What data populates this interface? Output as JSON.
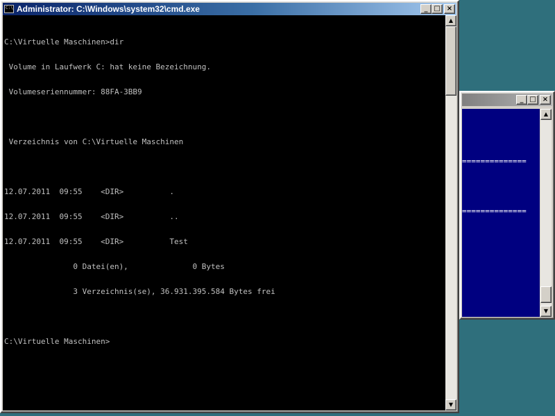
{
  "cmd_window": {
    "title": "Administrator: C:\\Windows\\system32\\cmd.exe",
    "icon_glyph": "C:\\",
    "buttons": {
      "minimize": "_",
      "maximize": "□",
      "close": "×"
    },
    "console_lines": [
      "C:\\Virtuelle Maschinen>dir",
      " Volume in Laufwerk C: hat keine Bezeichnung.",
      " Volumeseriennummer: 88FA-3BB9",
      "",
      " Verzeichnis von C:\\Virtuelle Maschinen",
      "",
      "12.07.2011  09:55    <DIR>          .",
      "12.07.2011  09:55    <DIR>          ..",
      "12.07.2011  09:55    <DIR>          Test",
      "               0 Datei(en),              0 Bytes",
      "               3 Verzeichnis(se), 36.931.395.584 Bytes frei",
      "",
      "C:\\Virtuelle Maschinen>"
    ],
    "scrollbar": {
      "up": "▲",
      "down": "▼"
    }
  },
  "background_window": {
    "buttons": {
      "minimize": "_",
      "maximize": "□",
      "close": "×"
    },
    "lines": [
      "",
      "==============",
      "",
      "==============",
      ""
    ],
    "scrollbar": {
      "up": "▲",
      "down": "▼"
    }
  },
  "colors": {
    "desktop": "#2f6f7c",
    "console_bg": "#000000",
    "console_text": "#c0c0c0",
    "blue_console_bg": "#000080"
  }
}
